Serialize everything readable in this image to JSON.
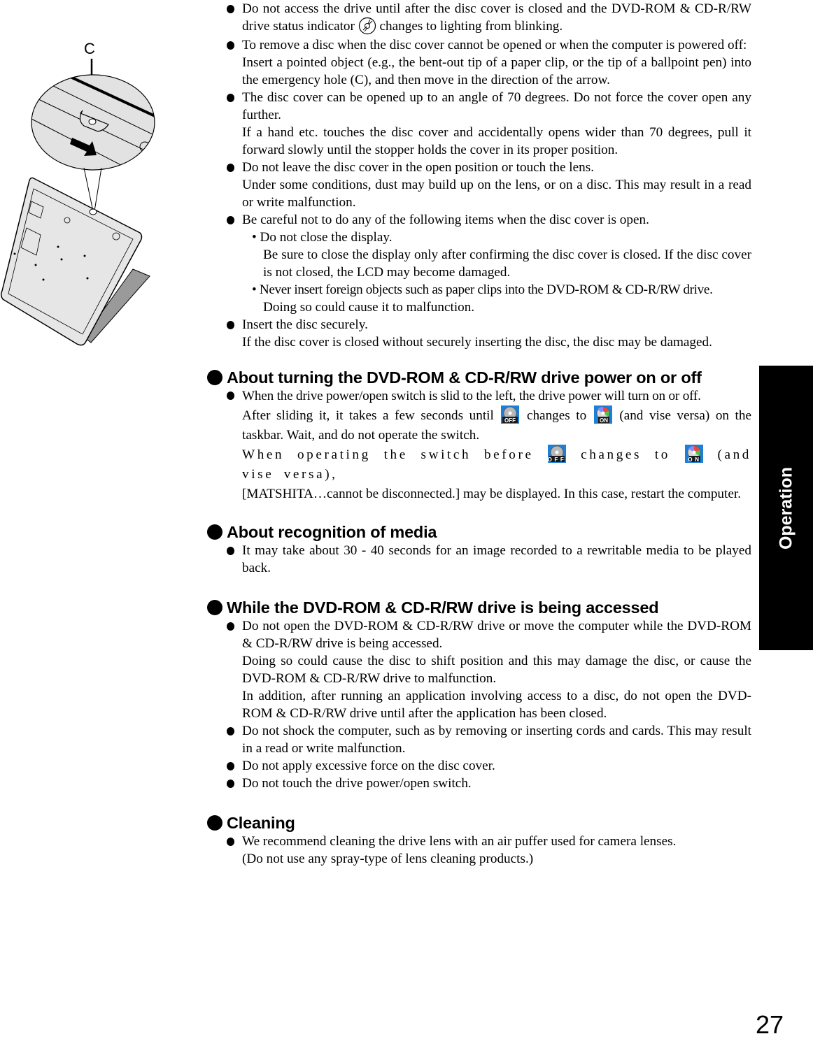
{
  "illustration": {
    "callout_label": "C",
    "alt": "Laptop with emergency hole (C) and arrow showing direction"
  },
  "intro_items": [
    {
      "lines": [
        "Do not access the drive until after the disc cover is closed and the DVD-ROM & CD-R/RW drive status indicator"
      ],
      "after_icon": "changes to lighting from blinking.",
      "icon": "disc-indicator-icon"
    },
    {
      "lines": [
        "To remove a disc when the disc cover cannot be opened or when the computer is powered off:",
        "Insert a pointed object (e.g., the bent-out tip of a paper clip, or the tip of a ballpoint pen) into the emergency hole (C), and then move in the direction of the arrow."
      ]
    },
    {
      "lines": [
        "The disc cover can be opened up to an angle of 70 degrees. Do not force the cover open any further.",
        "If a hand etc. touches the disc cover and accidentally opens wider than 70 degrees, pull it forward slowly until the stopper holds the cover in its proper position."
      ]
    },
    {
      "lines": [
        "Do not leave the disc cover in the open position or touch the lens.",
        "Under some conditions, dust may build up on the lens, or on a disc. This may result in a read or write malfunction."
      ]
    },
    {
      "lines": [
        "Be careful not to do any of the following items when the disc cover is open."
      ],
      "subitems": [
        {
          "title": "• Do not close the display.",
          "detail": "Be sure to close the display only after confirming the disc cover is closed. If the disc cover is not closed, the LCD may become damaged."
        },
        {
          "title": "• Never insert foreign objects such as paper clips into the DVD-ROM & CD-R/RW drive.",
          "detail": "Doing so could cause it to malfunction."
        }
      ]
    },
    {
      "lines": [
        "Insert the disc securely.",
        "If the disc cover is closed without securely inserting the disc, the disc may be damaged."
      ]
    }
  ],
  "sections": {
    "power": {
      "heading": "About turning the DVD-ROM & CD-R/RW drive power on or off",
      "line1": "When the drive power/open switch is slid to the left, the drive power will turn on or off.",
      "line2a": "After sliding it, it takes a few seconds until",
      "line2b": "changes to",
      "line2c": "(and vise versa) on the taskbar. Wait, and do not operate the switch.",
      "line3a": "When operating the switch before",
      "line3b": "changes to",
      "line3c": "(and vise versa),",
      "line4": "[MATSHITA…cannot be disconnected.] may be displayed. In this case, restart the computer.",
      "icon_off_label": "OFF",
      "icon_on_label": "ON"
    },
    "media": {
      "heading": "About recognition of media",
      "items": [
        "It may take about 30 - 40 seconds for an image recorded to a rewritable media to be played back."
      ]
    },
    "accessed": {
      "heading": "While the DVD-ROM & CD-R/RW drive is being accessed",
      "items": [
        [
          "Do not open the DVD-ROM & CD-R/RW drive or move the computer while the DVD-ROM & CD-R/RW drive is being accessed.",
          "Doing so could cause the disc to shift position and this may damage the disc, or cause the DVD-ROM & CD-R/RW drive to malfunction.",
          "In addition, after running an application involving access to a disc, do not open the DVD-ROM & CD-R/RW drive until after the application has been closed."
        ],
        [
          "Do not shock the computer, such as by removing or inserting cords and cards. This may result in a read or write malfunction."
        ],
        [
          "Do not apply excessive force on the disc cover."
        ],
        [
          "Do not touch the drive power/open switch."
        ]
      ]
    },
    "cleaning": {
      "heading": "Cleaning",
      "items": [
        [
          "We recommend cleaning the drive lens with an air puffer used for camera lenses.",
          "(Do not use any spray-type of lens cleaning products.)"
        ]
      ]
    }
  },
  "side_tab": {
    "label": "Operation"
  },
  "page_number": "27",
  "colors": {
    "tab_background": "#000000",
    "tab_text": "#ffffff",
    "icon_blue": "#1e7fd6"
  }
}
